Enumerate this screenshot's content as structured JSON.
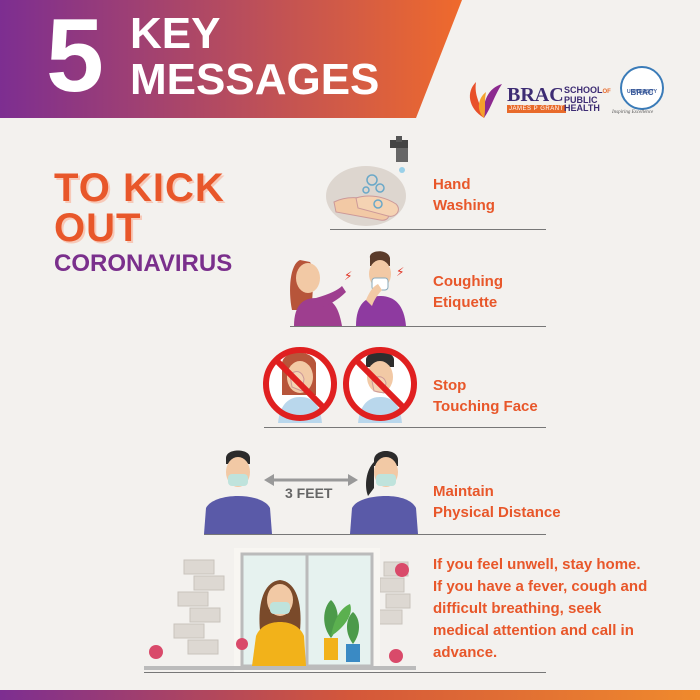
{
  "header": {
    "number": "5",
    "line1": "KEY",
    "line2": "MESSAGES",
    "gradient_start": "#7d2e91",
    "gradient_end": "#ef6a2c"
  },
  "logos": {
    "brac": "BRAC",
    "james": "JAMES P GRANT",
    "school": "SCHOOL",
    "of": "OF",
    "public": "PUBLIC",
    "health": "HEALTH",
    "univ_line1": "BRAC",
    "univ_line2": "UNIVERSITY",
    "tagline": "Inspiring Excellence"
  },
  "title": {
    "line1": "TO KICK",
    "line2": "OUT",
    "line3": "CORONAVIRUS"
  },
  "messages": [
    {
      "line1": "Hand",
      "line2": "Washing",
      "icon": "hand-washing-icon"
    },
    {
      "line1": "Coughing",
      "line2": "Etiquette",
      "icon": "coughing-icon"
    },
    {
      "line1": "Stop",
      "line2": "Touching Face",
      "icon": "no-touch-face-icon"
    },
    {
      "line1": "Maintain",
      "line2": "Physical Distance",
      "icon": "distance-icon"
    }
  ],
  "distance_label": "3 FEET",
  "advice": [
    "If you feel unwell, stay home.",
    "If you have a fever, cough and",
    "difficult breathing, seek",
    "medical attention and call in",
    "advance."
  ],
  "colors": {
    "accent": "#e8572a",
    "purple": "#7a2f8c",
    "skin": "#f2c9a5"
  }
}
